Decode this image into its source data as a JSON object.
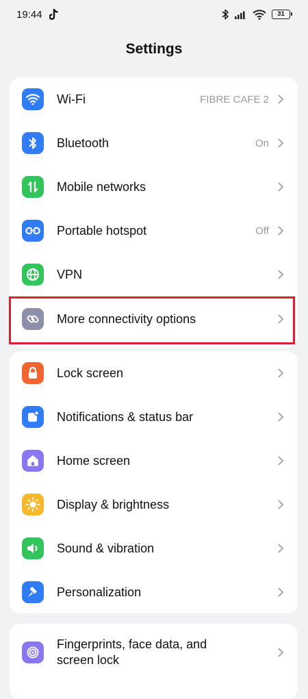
{
  "status": {
    "time": "19:44",
    "battery": "31"
  },
  "title": "Settings",
  "groups": [
    {
      "items": [
        {
          "label": "Wi-Fi",
          "value": "FIBRE CAFE 2",
          "icon": "wifi-icon",
          "color": "#2f7cf6"
        },
        {
          "label": "Bluetooth",
          "value": "On",
          "icon": "bluetooth-icon",
          "color": "#2f7cf6"
        },
        {
          "label": "Mobile networks",
          "value": "",
          "icon": "mobile-data-icon",
          "color": "#33c45b"
        },
        {
          "label": "Portable hotspot",
          "value": "Off",
          "icon": "hotspot-icon",
          "color": "#2f7cf6"
        },
        {
          "label": "VPN",
          "value": "",
          "icon": "globe-icon",
          "color": "#33c45b"
        },
        {
          "label": "More connectivity options",
          "value": "",
          "icon": "link-icon",
          "color": "#8e8fa8"
        }
      ]
    },
    {
      "items": [
        {
          "label": "Lock screen",
          "value": "",
          "icon": "lock-icon",
          "color": "#f26430"
        },
        {
          "label": "Notifications & status bar",
          "value": "",
          "icon": "notification-icon",
          "color": "#2f7cf6"
        },
        {
          "label": "Home screen",
          "value": "",
          "icon": "home-icon",
          "color": "#8a78f0"
        },
        {
          "label": "Display & brightness",
          "value": "",
          "icon": "sun-icon",
          "color": "#f7b92b"
        },
        {
          "label": "Sound & vibration",
          "value": "",
          "icon": "speaker-icon",
          "color": "#33c45b"
        },
        {
          "label": "Personalization",
          "value": "",
          "icon": "brush-icon",
          "color": "#2f7cf6"
        }
      ]
    },
    {
      "items": [
        {
          "label": "Fingerprints, face data, and screen lock",
          "value": "",
          "icon": "fingerprint-icon",
          "color": "#8a78f0"
        }
      ]
    }
  ]
}
